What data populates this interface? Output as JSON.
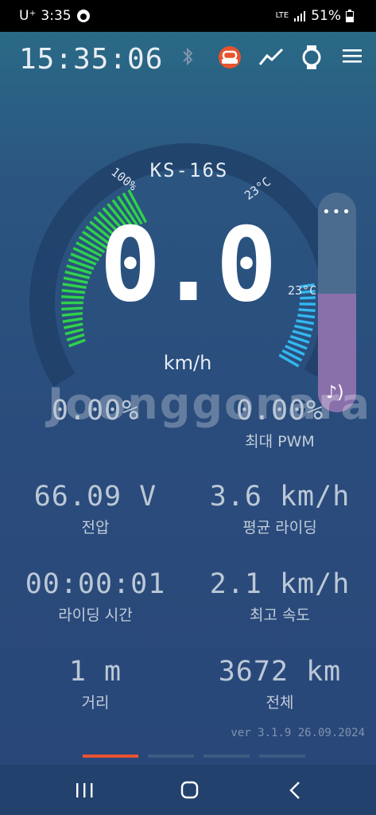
{
  "status_bar": {
    "carrier": "U⁺",
    "time": "3:35",
    "network": "LTE",
    "battery": "51%"
  },
  "header": {
    "clock": "15:35:06",
    "icons": [
      "bluetooth-icon",
      "wheel-icon",
      "chart-icon",
      "watch-icon",
      "menu-icon"
    ]
  },
  "gauge": {
    "model": "KS-16S",
    "speed": "0.0",
    "unit": "km/h",
    "battery_label": "100%",
    "temp_top": "23°C",
    "temp_right": "23°C",
    "battery_level": 1.0,
    "colors": {
      "battery": "#2fd24a",
      "temperature": "#33b8ef",
      "volume": "#8a70ab"
    }
  },
  "volume_slider": {
    "level": 0.54,
    "menu_icon": "more-dots-icon",
    "note_icon": "music-volume-icon"
  },
  "watermark": "Joonggonara",
  "stats": [
    {
      "value": "0.00%",
      "caption": ""
    },
    {
      "value": "0.00%",
      "caption": "최대 PWM"
    },
    {
      "value": "66.09 V",
      "caption": "전압"
    },
    {
      "value": "3.6 km/h",
      "caption": "평균 라이딩"
    },
    {
      "value": "00:00:01",
      "caption": "라이딩 시간"
    },
    {
      "value": "2.1 km/h",
      "caption": "최고 속도"
    },
    {
      "value": "1 m",
      "caption": "거리"
    },
    {
      "value": "3672 km",
      "caption": "전체"
    }
  ],
  "version": "ver 3.1.9 26.09.2024",
  "pager": {
    "pages": 4,
    "active": 0
  },
  "navbar": [
    "recent-apps-icon",
    "home-icon",
    "back-icon"
  ]
}
